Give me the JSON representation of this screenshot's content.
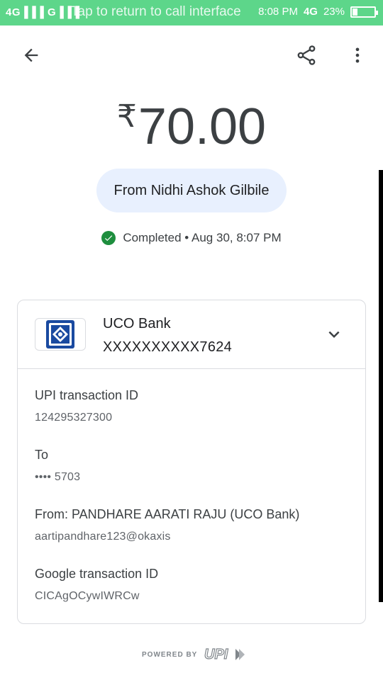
{
  "status_bar": {
    "signal_left": "4G▐▐▐ G▐▐▐",
    "overlay_text": "Tap to return to call interface",
    "clock": "8:08 PM",
    "network": "4G",
    "battery_percent": "23%",
    "battery_level": 0.23
  },
  "toolbar": {
    "back_icon": "arrow-back-icon",
    "share_icon": "share-icon",
    "more_icon": "more-vert-icon"
  },
  "payment": {
    "currency_symbol": "₹",
    "amount": "70.00",
    "from_label": "From Nidhi Ashok Gilbile",
    "status": "Completed",
    "date": "• Aug 30, 8:07 PM"
  },
  "bank": {
    "name": "UCO Bank",
    "account": "XXXXXXXXXX7624"
  },
  "details": [
    {
      "label": "UPI transaction ID",
      "value": "124295327300"
    },
    {
      "label": "To",
      "value": "•••• 5703"
    },
    {
      "label": "From: PANDHARE AARATI RAJU (UCO Bank)",
      "value": "aartipandhare123@okaxis"
    },
    {
      "label": "Google transaction ID",
      "value": "CICAgOCywIWRCw"
    }
  ],
  "footer": {
    "powered_by": "POWERED BY",
    "upi_logo_text": "UPI"
  },
  "colors": {
    "status_bar": "#5dd68a",
    "pill_bg": "#e8f0fe",
    "success": "#1e8e3e",
    "uco_blue": "#1a4aa0"
  }
}
